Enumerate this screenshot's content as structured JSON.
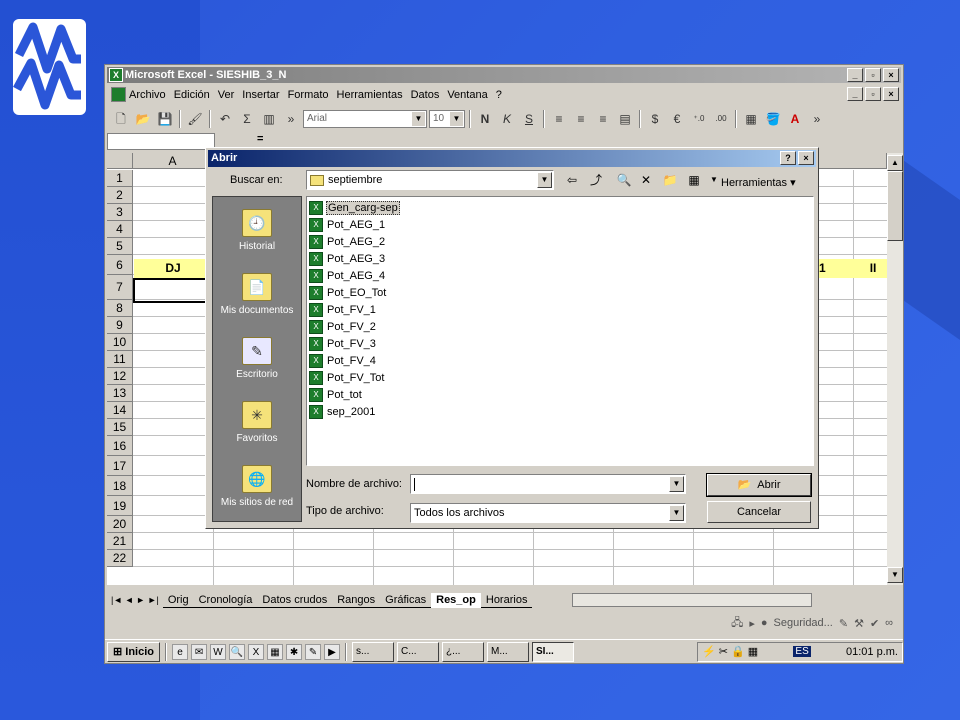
{
  "excel": {
    "title": "Microsoft Excel - SIESHIB_3_N",
    "menus": [
      "Archivo",
      "Edición",
      "Ver",
      "Insertar",
      "Formato",
      "Herramientas",
      "Datos",
      "Ventana",
      "?"
    ],
    "toolbar": {
      "font": "Arial",
      "size": "10"
    },
    "formula_eq": "=",
    "columns": [
      "A"
    ],
    "rows": [
      "1",
      "2",
      "3",
      "4",
      "5",
      "6",
      "7",
      "8",
      "9",
      "10",
      "11",
      "12",
      "13",
      "14",
      "15",
      "16",
      "17",
      "18",
      "19",
      "20",
      "21",
      "22"
    ],
    "cells": {
      "a6": "DJ",
      "right6a": "1",
      "right6b": "II"
    },
    "sheets": [
      "Orig",
      "Cronología",
      "Datos crudos",
      "Rangos",
      "Gráficas",
      "Res_op",
      "Horarios"
    ],
    "active_sheet": "Res_op",
    "status": {
      "security": "Seguridad..."
    }
  },
  "taskbar": {
    "start": "Inicio",
    "tasks": [
      "s...",
      "C...",
      "¿...",
      "M...",
      "SI..."
    ],
    "active_task": "SI...",
    "lang": "ES",
    "clock": "01:01 p.m."
  },
  "dialog": {
    "title": "Abrir",
    "lookin_label": "Buscar en:",
    "lookin_value": "septiembre",
    "tools_label": "Herramientas",
    "places": [
      "Historial",
      "Mis documentos",
      "Escritorio",
      "Favoritos",
      "Mis sitios de red"
    ],
    "files": [
      "Gen_carg-sep",
      "Pot_AEG_1",
      "Pot_AEG_2",
      "Pot_AEG_3",
      "Pot_AEG_4",
      "Pot_EO_Tot",
      "Pot_FV_1",
      "Pot_FV_2",
      "Pot_FV_3",
      "Pot_FV_4",
      "Pot_FV_Tot",
      "Pot_tot",
      "sep_2001"
    ],
    "filename_label": "Nombre de archivo:",
    "filename_value": "",
    "filetype_label": "Tipo de archivo:",
    "filetype_value": "Todos los archivos",
    "open_button": "Abrir",
    "cancel_button": "Cancelar"
  }
}
